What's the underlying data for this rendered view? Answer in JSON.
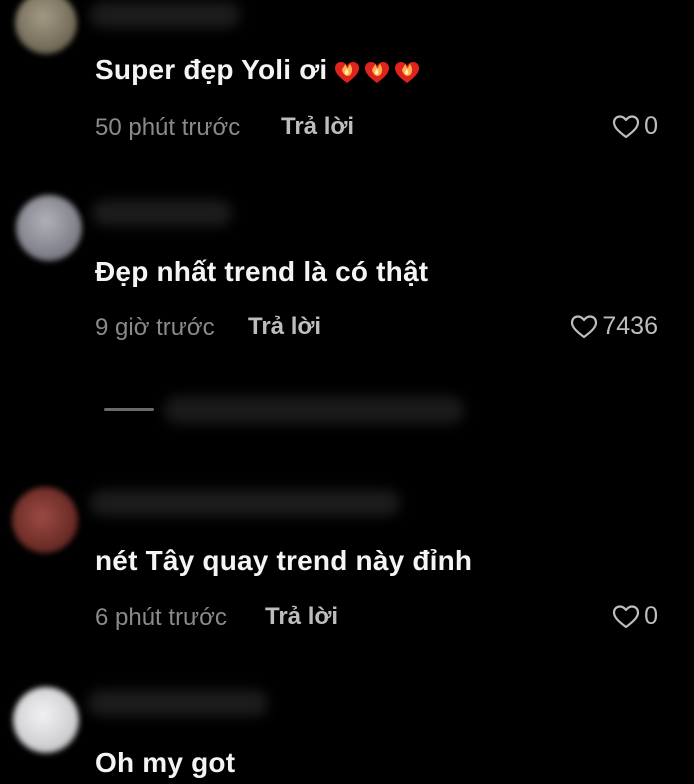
{
  "comments": [
    {
      "text": "Super đẹp Yoli ơi",
      "emoji": [
        "heart-on-fire",
        "heart-on-fire",
        "heart-on-fire"
      ],
      "time": "50 phút trước",
      "reply_label": "Trả lời",
      "likes": "0",
      "avatar_color": "#8d8470"
    },
    {
      "text": "Đẹp nhất trend là có thật",
      "time": "9 giờ trước",
      "reply_label": "Trả lời",
      "likes": "7436",
      "avatar_color": "#8c8c94"
    },
    {
      "text": "nét Tây quay trend này đỉnh",
      "time": "6 phút trước",
      "reply_label": "Trả lời",
      "likes": "0",
      "avatar_color": "#8a3c36"
    },
    {
      "text": "Oh my got",
      "avatar_color": "#d7d7d9"
    }
  ],
  "colors": {
    "background": "#000000",
    "comment_text": "#f4f4f4",
    "meta_text": "#8a8a8a",
    "action_text": "#bdbdbd"
  },
  "icons": {
    "like": "heart-outline-icon",
    "emoji": "heart-on-fire-emoji"
  }
}
